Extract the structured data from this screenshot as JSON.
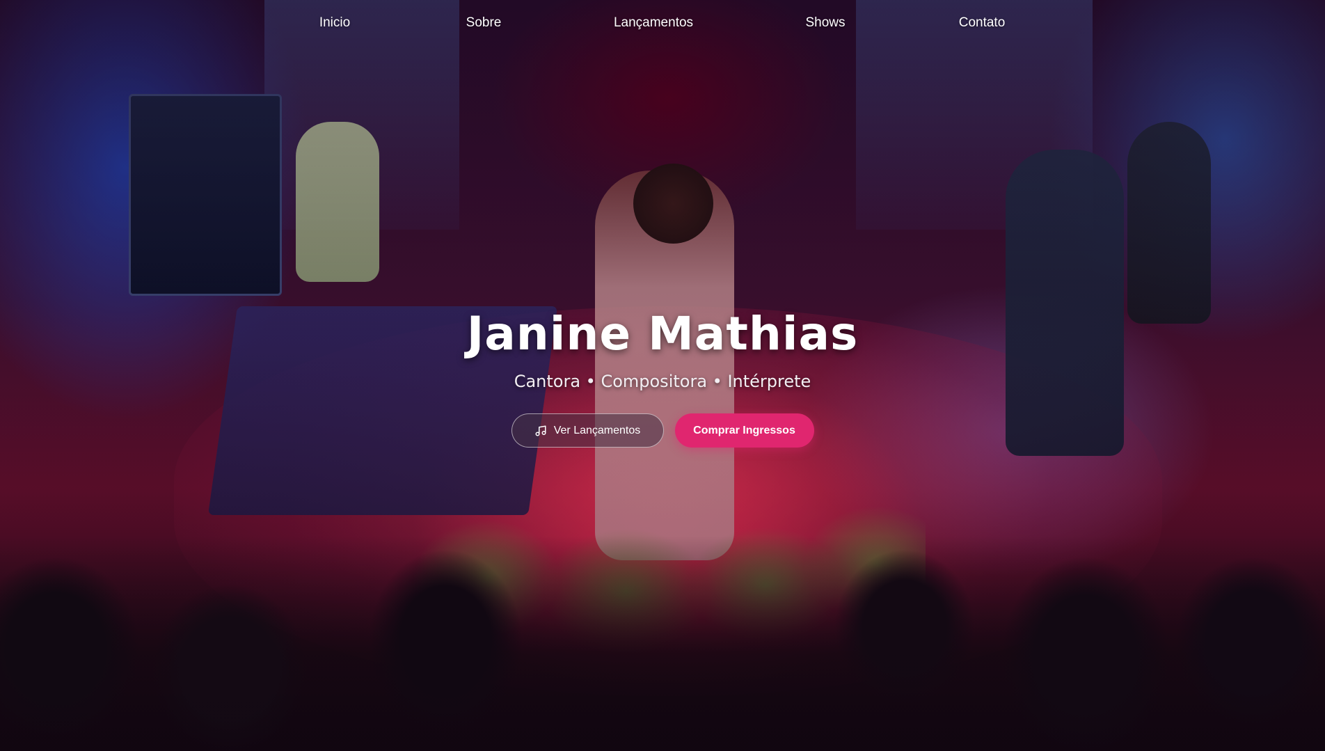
{
  "nav": {
    "items": [
      {
        "label": "Inicio"
      },
      {
        "label": "Sobre"
      },
      {
        "label": "Lançamentos"
      },
      {
        "label": "Shows"
      },
      {
        "label": "Contato"
      }
    ]
  },
  "hero": {
    "title": "Janine Mathias",
    "subtitle": "Cantora • Compositora • Intérprete",
    "secondary_button": {
      "label": "Ver Lançamentos",
      "icon": "music-note-icon"
    },
    "primary_button": {
      "label": "Comprar Ingressos",
      "color": "#e0266f"
    }
  }
}
